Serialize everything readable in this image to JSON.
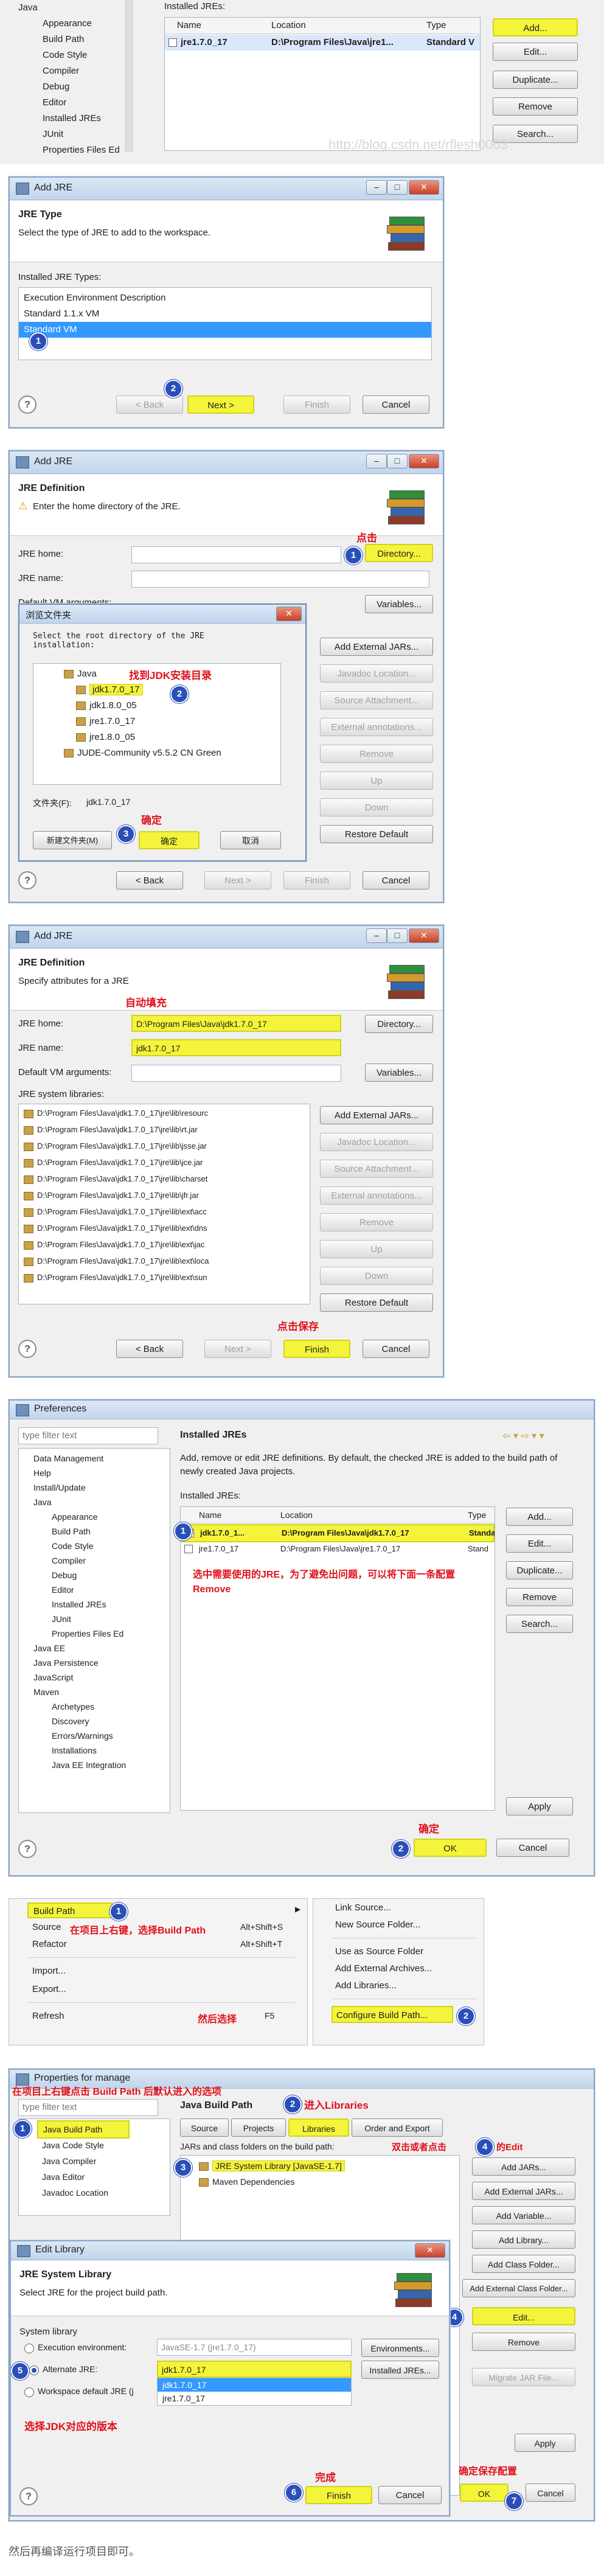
{
  "panel1": {
    "tree": [
      "Java",
      "Appearance",
      "Build Path",
      "Code Style",
      "Compiler",
      "Debug",
      "Editor",
      "Installed JREs",
      "JUnit",
      "Properties Files Ed"
    ],
    "installed_label": "Installed JREs:",
    "columns": [
      "Name",
      "Location",
      "Type"
    ],
    "row": {
      "name": "jre1.7.0_17",
      "location": "D:\\Program Files\\Java\\jre1...",
      "type": "Standard V"
    },
    "buttons": [
      "Add...",
      "Edit...",
      "Duplicate...",
      "Remove",
      "Search..."
    ]
  },
  "panel2": {
    "title": "Add JRE",
    "heading": "JRE Type",
    "subheading": "Select the type of JRE to add to the workspace.",
    "types_label": "Installed JRE Types:",
    "types": [
      "Execution Environment Description",
      "Standard 1.1.x VM",
      "Standard VM"
    ],
    "buttons": {
      "back": "< Back",
      "next": "Next >",
      "finish": "Finish",
      "cancel": "Cancel"
    },
    "help": "?"
  },
  "panel3": {
    "title": "Add JRE",
    "heading": "JRE Definition",
    "subheading": "Enter the home directory of the JRE.",
    "jre_home": "JRE home:",
    "jre_name": "JRE name:",
    "default_vm": "Default VM arguments:",
    "directory": "Directory...",
    "variables": "Variables...",
    "side_buttons": [
      "Add External JARs...",
      "Javadoc Location...",
      "Source Attachment...",
      "External annotations...",
      "Remove",
      "Up",
      "Down",
      "Restore Default"
    ],
    "annotation_click": "点击",
    "folder_dialog": {
      "title": "浏览文件夹",
      "prompt": "Select the root directory of the JRE installation:",
      "items": [
        "Java",
        "jdk1.7.0_17",
        "jdk1.8.0_05",
        "jre1.7.0_17",
        "jre1.8.0_05",
        "JUDE-Community v5.5.2 CN Green"
      ],
      "folder_label": "文件夹(F):",
      "folder_value": "jdk1.7.0_17",
      "new_folder": "新建文件夹(M)",
      "ok": "确定",
      "cancel": "取消",
      "annotation_find": "找到JDK安装目录",
      "annotation_ok": "确定"
    },
    "buttons": {
      "back": "< Back",
      "next": "Next >",
      "finish": "Finish",
      "cancel": "Cancel"
    },
    "help": "?"
  },
  "panel4": {
    "title": "Add JRE",
    "heading": "JRE Definition",
    "subheading": "Specify attributes for a JRE",
    "annotation_autofill": "自动填充",
    "jre_home": "JRE home:",
    "jre_home_value": "D:\\Program Files\\Java\\jdk1.7.0_17",
    "jre_name": "JRE name:",
    "jre_name_value": "jdk1.7.0_17",
    "default_vm": "Default VM arguments:",
    "directory": "Directory...",
    "variables": "Variables...",
    "libs_label": "JRE system libraries:",
    "libs": [
      "D:\\Program Files\\Java\\jdk1.7.0_17\\jre\\lib\\resourc",
      "D:\\Program Files\\Java\\jdk1.7.0_17\\jre\\lib\\rt.jar",
      "D:\\Program Files\\Java\\jdk1.7.0_17\\jre\\lib\\jsse.jar",
      "D:\\Program Files\\Java\\jdk1.7.0_17\\jre\\lib\\jce.jar",
      "D:\\Program Files\\Java\\jdk1.7.0_17\\jre\\lib\\charset",
      "D:\\Program Files\\Java\\jdk1.7.0_17\\jre\\lib\\jfr.jar",
      "D:\\Program Files\\Java\\jdk1.7.0_17\\jre\\lib\\ext\\acc",
      "D:\\Program Files\\Java\\jdk1.7.0_17\\jre\\lib\\ext\\dns",
      "D:\\Program Files\\Java\\jdk1.7.0_17\\jre\\lib\\ext\\jac",
      "D:\\Program Files\\Java\\jdk1.7.0_17\\jre\\lib\\ext\\loca",
      "D:\\Program Files\\Java\\jdk1.7.0_17\\jre\\lib\\ext\\sun"
    ],
    "side_buttons": [
      "Add External JARs...",
      "Javadoc Location...",
      "Source Attachment...",
      "External annotations...",
      "Remove",
      "Up",
      "Down",
      "Restore Default"
    ],
    "annotation_save": "点击保存",
    "buttons": {
      "back": "< Back",
      "next": "Next >",
      "finish": "Finish",
      "cancel": "Cancel"
    },
    "help": "?"
  },
  "panel5": {
    "title": "Preferences",
    "filter_placeholder": "type filter text",
    "tree": [
      "Data Management",
      "Help",
      "Install/Update",
      "Java",
      "Appearance",
      "Build Path",
      "Code Style",
      "Compiler",
      "Debug",
      "Editor",
      "Installed JREs",
      "JUnit",
      "Properties Files Ed",
      "Java EE",
      "Java Persistence",
      "JavaScript",
      "Maven",
      "Archetypes",
      "Discovery",
      "Errors/Warnings",
      "Installations",
      "Java EE Integration"
    ],
    "page_title": "Installed JREs",
    "description": "Add, remove or edit JRE definitions. By default, the checked JRE is added to the build path of newly created Java projects.",
    "installed_label": "Installed JREs:",
    "columns": [
      "Name",
      "Location",
      "Type"
    ],
    "rows": [
      {
        "name": "jdk1.7.0_1...",
        "location": "D:\\Program Files\\Java\\jdk1.7.0_17",
        "type": "Standa"
      },
      {
        "name": "jre1.7.0_17",
        "location": "D:\\Program Files\\Java\\jre1.7.0_17",
        "type": "Stand"
      }
    ],
    "annotation": "选中需要使用的JRE，为了避免出问题，可以将下面一条配置Remove",
    "buttons": [
      "Add...",
      "Edit...",
      "Duplicate...",
      "Remove",
      "Search..."
    ],
    "apply": "Apply",
    "annotation_ok": "确定",
    "ok": "OK",
    "cancel": "Cancel",
    "help": "?"
  },
  "panel6": {
    "menu_left": [
      {
        "label": "Build Path",
        "shortcut": ""
      },
      {
        "label": "Source",
        "shortcut": "Alt+Shift+S"
      },
      {
        "label": "Refactor",
        "shortcut": "Alt+Shift+T"
      },
      {
        "label": "Import...",
        "shortcut": ""
      },
      {
        "label": "Export...",
        "shortcut": ""
      },
      {
        "label": "Refresh",
        "shortcut": "F5"
      }
    ],
    "menu_right": [
      "Link Source...",
      "New Source Folder...",
      "Use as Source Folder",
      "Add External Archives...",
      "Add Libraries...",
      "Configure Build Path..."
    ],
    "annotation_rightclick": "在项目上右键，选择Build Path",
    "annotation_then": "然后选择"
  },
  "panel7": {
    "title": "Properties for manage",
    "annotation_top": "在项目上右键点击 Build Path 后默认进入的选项",
    "filter_placeholder": "type filter text",
    "tree": [
      "Java Build Path",
      "Java Code Style",
      "Java Compiler",
      "Java Editor",
      "Javadoc Location"
    ],
    "section_title": "Java Build Path",
    "annotation_libs": "进入Libraries",
    "tabs": [
      "Source",
      "Projects",
      "Libraries",
      "Order and Export"
    ],
    "jars_label": "JARs and class folders on the build path:",
    "libs": [
      "JRE System Library [JavaSE-1.7]",
      "Maven Dependencies"
    ],
    "annotation_edit": "双击或者点击",
    "annotation_edit2": "的Edit",
    "right_buttons": [
      "Add JARs...",
      "Add External JARs...",
      "Add Variable...",
      "Add Library...",
      "Add Class Folder...",
      "Add External Class Folder...",
      "Edit...",
      "Remove",
      "Migrate JAR File..."
    ],
    "apply": "Apply",
    "annotation_confirm": "确定保存配置",
    "ok": "OK",
    "cancel": "Cancel",
    "edit_dialog": {
      "title": "Edit Library",
      "heading": "JRE System Library",
      "subheading": "Select JRE for the project build path.",
      "system_library": "System library",
      "exec_env": "Execution environment:",
      "exec_env_value": "JavaSE-1.7 (jre1.7.0_17)",
      "environments": "Environments...",
      "alternate": "Alternate JRE:",
      "alternate_value": "jdk1.7.0_17",
      "alternate_options": [
        "jdk1.7.0_17",
        "jre1.7.0_17"
      ],
      "installed_jres": "Installed JREs...",
      "workspace_default": "Workspace default JRE (j",
      "annotation_choose": "选择JDK对应的版本",
      "annotation_finish": "完成",
      "finish": "Finish",
      "cancel": "Cancel",
      "help": "?"
    }
  },
  "footer": "然后再编译运行项目即可。",
  "watermark": "http://blog.csdn.net/rflesh0003",
  "colors": {
    "highlight": "#f4f43a",
    "annotation": "#e0101b",
    "badge": "#2a4fb8",
    "selection": "#3399ff"
  }
}
